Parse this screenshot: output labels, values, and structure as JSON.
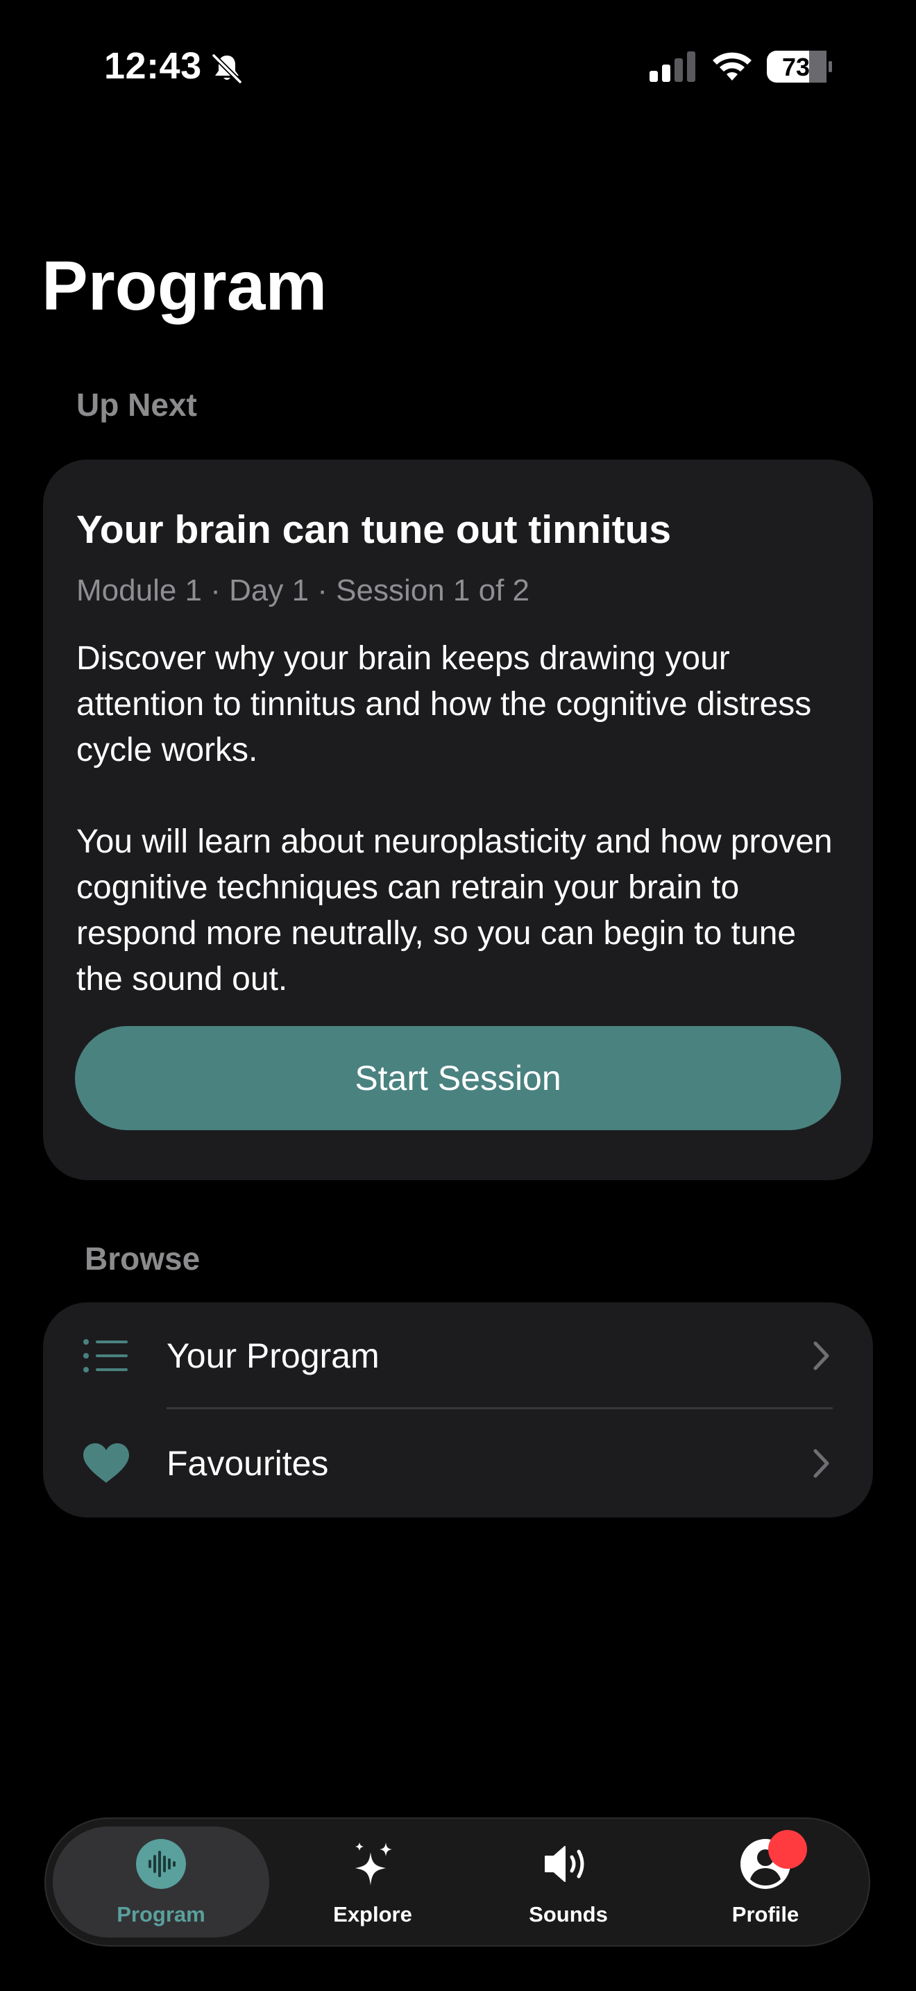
{
  "status_bar": {
    "time": "12:43",
    "battery": "73",
    "icons": [
      "bell-slash-icon",
      "cellular-signal-icon",
      "wifi-icon",
      "battery-icon"
    ]
  },
  "page": {
    "title": "Program"
  },
  "up_next": {
    "section_label": "Up Next",
    "title": "Your brain can tune out tinnitus",
    "meta": "Module 1 · Day 1 · Session 1 of 2",
    "description_1": "Discover why your brain keeps drawing your attention to tinnitus and how the cognitive distress cycle works.",
    "description_2": "You will learn about neuroplasticity and how proven cognitive techniques can retrain your brain to respond more neutrally, so you can begin to tune the sound out.",
    "button_label": "Start Session"
  },
  "browse": {
    "section_label": "Browse",
    "items": [
      {
        "label": "Your Program",
        "icon": "list-icon"
      },
      {
        "label": "Favourites",
        "icon": "heart-icon"
      }
    ]
  },
  "tab_bar": {
    "tabs": [
      {
        "label": "Program",
        "icon": "waveform-icon",
        "selected": true
      },
      {
        "label": "Explore",
        "icon": "sparkles-icon",
        "selected": false
      },
      {
        "label": "Sounds",
        "icon": "speaker-icon",
        "selected": false
      },
      {
        "label": "Profile",
        "icon": "person-circle-icon",
        "selected": false,
        "has_badge": true
      }
    ]
  },
  "colors": {
    "background": "#000000",
    "card": "#1c1c1e",
    "accent": "#4a8280",
    "accent_text": "#5aa09d",
    "secondary_text": "#8e8e93",
    "badge": "#ff3b40"
  }
}
